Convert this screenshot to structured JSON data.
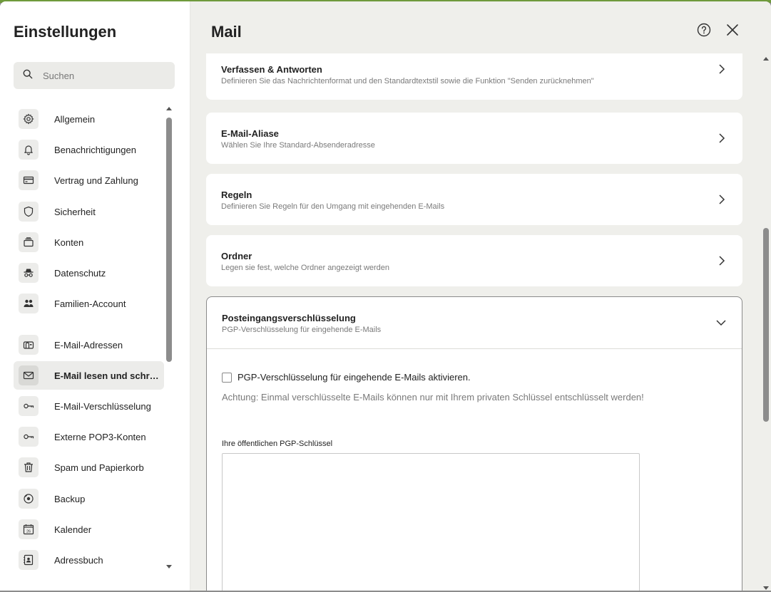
{
  "sidebar": {
    "title": "Einstellungen",
    "search_placeholder": "Suchen",
    "items": [
      {
        "label": "Allgemein",
        "icon": "gear-icon"
      },
      {
        "label": "Benachrichtigungen",
        "icon": "bell-icon"
      },
      {
        "label": "Vertrag und Zahlung",
        "icon": "credit-card-icon"
      },
      {
        "label": "Sicherheit",
        "icon": "shield-icon"
      },
      {
        "label": "Konten",
        "icon": "accounts-icon"
      },
      {
        "label": "Datenschutz",
        "icon": "incognito-icon"
      },
      {
        "label": "Familien-Account",
        "icon": "family-icon"
      },
      {
        "label": "E-Mail-Adressen",
        "icon": "mailbox-icon"
      },
      {
        "label": "E-Mail lesen und schreiben",
        "icon": "envelope-icon",
        "active": true
      },
      {
        "label": "E-Mail-Verschlüsselung",
        "icon": "key-icon"
      },
      {
        "label": "Externe POP3-Konten",
        "icon": "key-icon"
      },
      {
        "label": "Spam und Papierkorb",
        "icon": "trash-icon"
      },
      {
        "label": "Backup",
        "icon": "backup-disc-icon"
      },
      {
        "label": "Kalender",
        "icon": "calendar-icon",
        "calendar_day": "26"
      },
      {
        "label": "Adressbuch",
        "icon": "address-book-icon"
      }
    ]
  },
  "main": {
    "title": "Mail",
    "help_icon": "help-circle-icon",
    "close_icon": "close-icon",
    "cards": [
      {
        "title": "Verfassen & Antworten",
        "subtitle": "Definieren Sie das Nachrichtenformat und den Standardtextstil sowie die Funktion \"Senden zurücknehmen\""
      },
      {
        "title": "E-Mail-Aliase",
        "subtitle": "Wählen Sie Ihre Standard-Absenderadresse"
      },
      {
        "title": "Regeln",
        "subtitle": "Definieren Sie Regeln für den Umgang mit eingehenden E-Mails"
      },
      {
        "title": "Ordner",
        "subtitle": "Legen sie fest, welche Ordner angezeigt werden"
      }
    ],
    "encryption": {
      "title": "Posteingangsverschlüsselung",
      "subtitle": "PGP-Verschlüsselung für eingehende E-Mails",
      "checkbox_label": "PGP-Verschlüsselung für eingehende E-Mails aktivieren.",
      "checkbox_checked": false,
      "warning": "Achtung: Einmal verschlüsselte E-Mails können nur mit Ihrem privaten Schlüssel entschlüsselt werden!",
      "key_label": "Ihre öffentlichen PGP-Schlüssel",
      "key_value": ""
    }
  }
}
